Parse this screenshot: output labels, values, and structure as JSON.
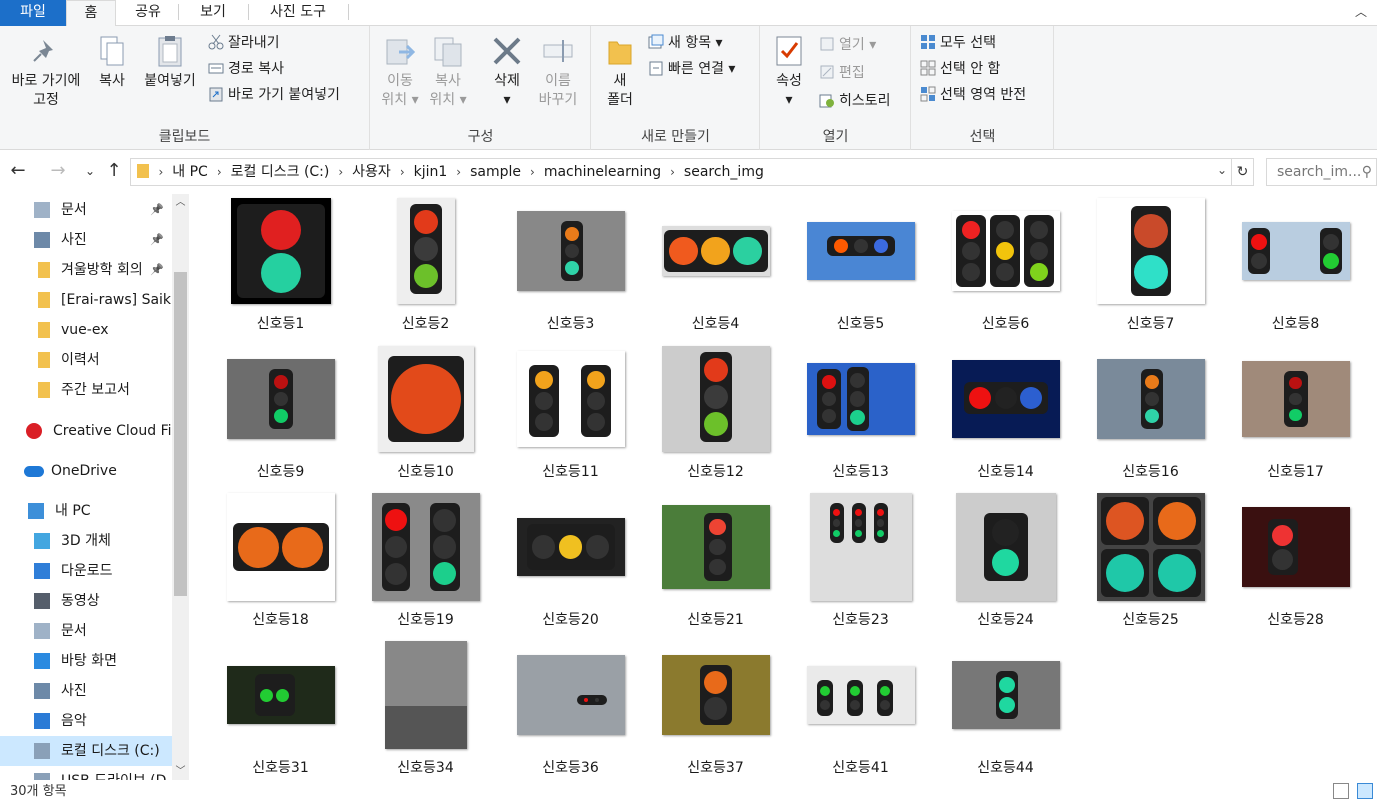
{
  "ribbon_tabs": {
    "file": "파일",
    "home": "홈",
    "share": "공유",
    "view": "보기",
    "picture_tools": "사진 도구"
  },
  "clipboard": {
    "pin_label_1": "바로 가기에",
    "pin_label_2": "고정",
    "copy": "복사",
    "paste": "붙여넣기",
    "cut": "잘라내기",
    "copy_path": "경로 복사",
    "paste_shortcut": "바로 가기 붙여넣기",
    "group": "클립보드"
  },
  "organize": {
    "move_1": "이동",
    "move_2": "위치",
    "copyto_1": "복사",
    "copyto_2": "위치",
    "delete": "삭제",
    "rename_1": "이름",
    "rename_2": "바꾸기",
    "group": "구성"
  },
  "new": {
    "folder_1": "새",
    "folder_2": "폴더",
    "new_item": "새 항목",
    "easy_access": "빠른 연결",
    "group": "새로 만들기"
  },
  "open": {
    "properties": "속성",
    "open": "열기",
    "edit": "편집",
    "history": "히스토리",
    "group": "열기"
  },
  "select": {
    "all": "모두 선택",
    "none": "선택 안 함",
    "invert": "선택 영역 반전",
    "group": "선택"
  },
  "breadcrumbs": [
    "내 PC",
    "로컬 디스크 (C:)",
    "사용자",
    "kjin1",
    "sample",
    "machinelearning",
    "search_img"
  ],
  "search_placeholder": "search_im...",
  "sidebar": [
    {
      "label": "문서",
      "icon": "document-icon",
      "pinned": true
    },
    {
      "label": "사진",
      "icon": "pictures-icon",
      "pinned": true
    },
    {
      "label": "겨울방학 회의",
      "icon": "folder-icon",
      "pinned": true
    },
    {
      "label": "[Erai-raws] Saiki",
      "icon": "folder-icon",
      "pinned": false
    },
    {
      "label": "vue-ex",
      "icon": "folder-icon",
      "pinned": false
    },
    {
      "label": "이력서",
      "icon": "folder-icon",
      "pinned": false
    },
    {
      "label": "주간 보고서",
      "icon": "folder-icon",
      "pinned": false
    },
    {
      "label": "Creative Cloud Fil",
      "icon": "creative-cloud-icon",
      "pinned": false
    },
    {
      "label": "OneDrive",
      "icon": "onedrive-icon",
      "pinned": false
    },
    {
      "label": "내 PC",
      "icon": "computer-icon",
      "pinned": false
    },
    {
      "label": "3D 개체",
      "icon": "3d-objects-icon",
      "pinned": false
    },
    {
      "label": "다운로드",
      "icon": "download-icon",
      "pinned": false
    },
    {
      "label": "동영상",
      "icon": "video-icon",
      "pinned": false
    },
    {
      "label": "문서",
      "icon": "document-icon",
      "pinned": false
    },
    {
      "label": "바탕 화면",
      "icon": "desktop-icon",
      "pinned": false
    },
    {
      "label": "사진",
      "icon": "pictures-icon",
      "pinned": false
    },
    {
      "label": "음악",
      "icon": "music-icon",
      "pinned": false
    },
    {
      "label": "로컬 디스크 (C:)",
      "icon": "drive-icon",
      "pinned": false
    },
    {
      "label": "USB 드라이브 (D",
      "icon": "usb-icon",
      "pinned": false
    }
  ],
  "files": [
    "신호등1",
    "신호등2",
    "신호등3",
    "신호등4",
    "신호등5",
    "신호등6",
    "신호등7",
    "신호등8",
    "신호등9",
    "신호등10",
    "신호등11",
    "신호등12",
    "신호등13",
    "신호등14",
    "신호등16",
    "신호등17",
    "신호등18",
    "신호등19",
    "신호등20",
    "신호등21",
    "신호등23",
    "신호등24",
    "신호등25",
    "신호등28",
    "신호등31",
    "신호등34",
    "신호등36",
    "신호등37",
    "신호등41",
    "신호등44"
  ],
  "status": {
    "item_count": "30개 항목"
  },
  "colors": {
    "accent": "#1c6fc9",
    "selection": "#cce8ff"
  }
}
